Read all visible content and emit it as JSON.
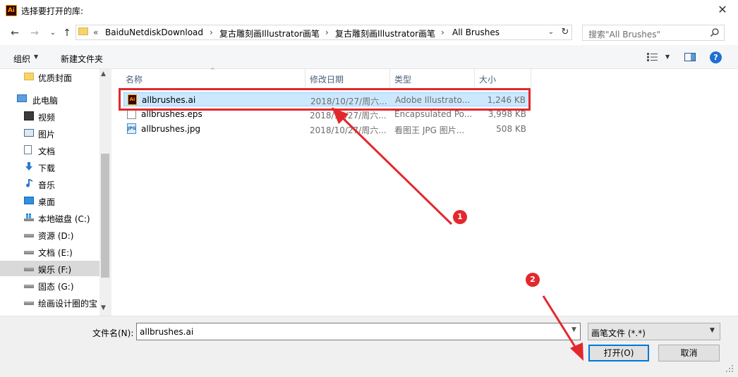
{
  "window": {
    "title": "选择要打开的库:",
    "app_icon_text": "Ai",
    "close_symbol": "✕"
  },
  "address_bar": {
    "overflow": "«",
    "crumbs": [
      "BaiduNetdiskDownload",
      "复古雕刻画Illustrator画笔",
      "复古雕刻画Illustrator画笔",
      "All Brushes"
    ],
    "separator": "›",
    "dropdown_symbol": "⌄",
    "refresh_symbol": "↻"
  },
  "nav": {
    "back": "←",
    "forward": "→",
    "recent": "⌄",
    "up": "↑"
  },
  "search": {
    "placeholder": "搜索\"All Brushes\""
  },
  "toolbar": {
    "organize_label": "组织",
    "organize_arrow": "▼",
    "new_folder_label": "新建文件夹",
    "view_arrow": "▼",
    "help_symbol": "?"
  },
  "sidebar": {
    "items": [
      {
        "label": "优质封面",
        "icon": "folder-icon"
      },
      {
        "label": "此电脑",
        "icon": "computer-icon"
      },
      {
        "label": "视频",
        "icon": "video-icon"
      },
      {
        "label": "图片",
        "icon": "pictures-icon"
      },
      {
        "label": "文档",
        "icon": "documents-icon"
      },
      {
        "label": "下载",
        "icon": "download-icon"
      },
      {
        "label": "音乐",
        "icon": "music-icon"
      },
      {
        "label": "桌面",
        "icon": "desktop-icon"
      },
      {
        "label": "本地磁盘 (C:)",
        "icon": "system-drive-icon"
      },
      {
        "label": "资源 (D:)",
        "icon": "drive-icon"
      },
      {
        "label": "文档 (E:)",
        "icon": "drive-icon"
      },
      {
        "label": "娱乐 (F:)",
        "icon": "drive-icon"
      },
      {
        "label": "固态 (G:)",
        "icon": "drive-icon"
      },
      {
        "label": "绘画设计圈的宝",
        "icon": "drive-icon"
      }
    ],
    "scroll_up": "▲",
    "scroll_down": "▼"
  },
  "file_list": {
    "columns": {
      "name": "名称",
      "date": "修改日期",
      "type": "类型",
      "size": "大小"
    },
    "sort_indicator": "^",
    "rows": [
      {
        "name": "allbrushes.ai",
        "date": "2018/10/27/周六...",
        "type": "Adobe Illustrato...",
        "size": "1,246 KB",
        "icon": "ai-file-icon"
      },
      {
        "name": "allbrushes.eps",
        "date": "2018/10/27/周六...",
        "type": "Encapsulated Po...",
        "size": "3,998 KB",
        "icon": "eps-file-icon"
      },
      {
        "name": "allbrushes.jpg",
        "date": "2018/10/27/周六...",
        "type": "看图王 JPG 图片...",
        "size": "508 KB",
        "icon": "jpg-file-icon"
      }
    ],
    "jpg_icon_text": "JPG",
    "ai_icon_text": "Ai"
  },
  "annotations": {
    "step1": "1",
    "step2": "2",
    "color": "#e3282d"
  },
  "bottom": {
    "filename_label": "文件名(N):",
    "filename_value": "allbrushes.ai",
    "filename_dd": "▼",
    "filter_value": "画笔文件 (*.*)",
    "filter_arrow": "▼",
    "open_label": "打开(O)",
    "cancel_label": "取消"
  },
  "colors": {
    "selection_bg": "#cce8ff",
    "accent": "#0078d7",
    "header_text": "#4c607a"
  }
}
